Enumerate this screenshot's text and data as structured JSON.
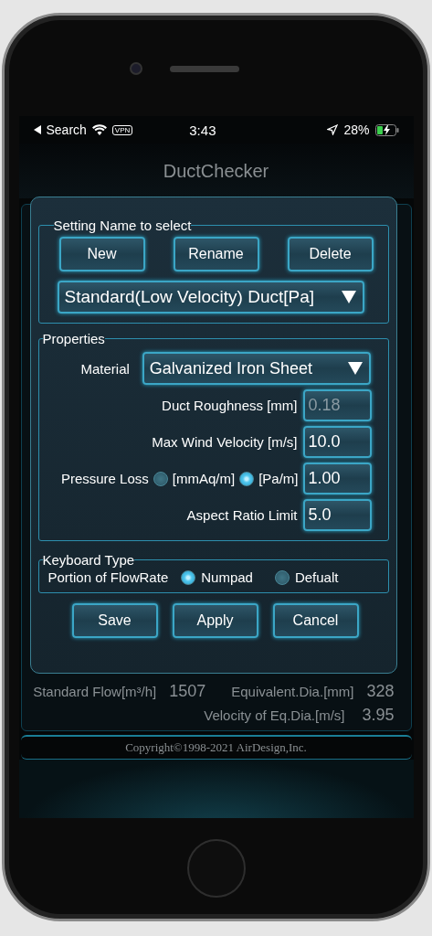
{
  "status_bar": {
    "back_label": "Search",
    "vpn": "VPN",
    "time": "3:43",
    "battery": "28%"
  },
  "app_title": "DuctChecker",
  "dialog": {
    "setting_group": {
      "title": "Setting Name to select",
      "buttons": [
        "New",
        "Rename",
        "Delete"
      ],
      "selected_setting": "Standard(Low Velocity) Duct[Pa]"
    },
    "properties": {
      "title": "Properties",
      "rows": [
        {
          "kind": "select",
          "label": "Material",
          "value": "Galvanized Iron Sheet"
        },
        {
          "kind": "field",
          "label": "Duct Roughness [mm]",
          "value": "0.18",
          "disabled": true
        },
        {
          "kind": "field",
          "label": "Max Wind Velocity [m/s]",
          "value": "10.0",
          "disabled": false
        },
        {
          "kind": "radio_field",
          "label": "Pressure Loss",
          "options": [
            {
              "label": "[mmAq/m]",
              "selected": false
            },
            {
              "label": "[Pa/m]",
              "selected": true
            }
          ],
          "value": "1.00",
          "disabled": false
        },
        {
          "kind": "field",
          "label": "Aspect Ratio Limit",
          "value": "5.0",
          "disabled": false
        }
      ]
    },
    "keyboard_type": {
      "title": "Keyboard Type",
      "label": "Portion of FlowRate",
      "options": [
        {
          "label": "Numpad",
          "selected": true
        },
        {
          "label": "Defualt",
          "selected": false
        }
      ]
    },
    "actions": [
      "Save",
      "Apply",
      "Cancel"
    ]
  },
  "results": [
    {
      "cells": [
        {
          "label": "Standard Flow[m³/h]",
          "value": "1507"
        },
        {
          "label": "Equivalent.Dia.[mm]",
          "value": "328"
        }
      ]
    },
    {
      "cells": [
        {
          "label": "Velocity of Eq.Dia.[m/s]",
          "value": "3.95"
        }
      ]
    }
  ],
  "copyright": "Copyright©1998-2021 AirDesign,Inc."
}
